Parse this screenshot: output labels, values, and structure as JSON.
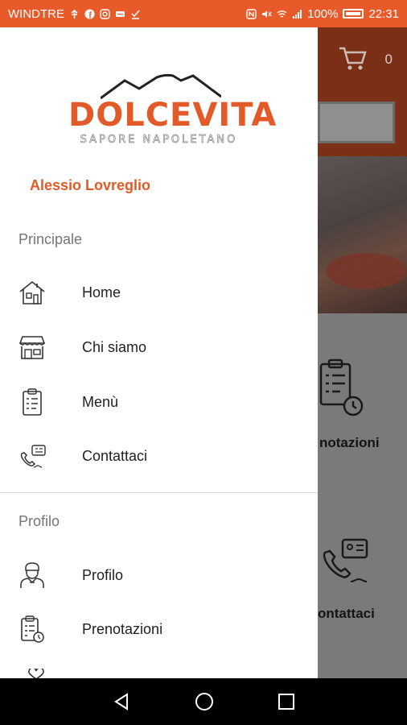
{
  "status_bar": {
    "carrier": "WINDTRE",
    "battery": "100%",
    "time": "22:31",
    "color": "#e85a2a"
  },
  "background": {
    "cart_count": "0",
    "tile_1_label": "notazioni",
    "tile_2_label": "ontattaci"
  },
  "drawer": {
    "logo": {
      "brand": "DOLCEVITA",
      "tagline": "SAPORE NAPOLETANO"
    },
    "user_name": "Alessio Lovreglio",
    "sections": {
      "main": "Principale",
      "profile": "Profilo"
    },
    "main_items": [
      {
        "label": "Home",
        "icon": "house-icon"
      },
      {
        "label": "Chi siamo",
        "icon": "shop-icon"
      },
      {
        "label": "Menù",
        "icon": "clipboard-list-icon"
      },
      {
        "label": "Contattaci",
        "icon": "phone-contact-icon"
      }
    ],
    "profile_items": [
      {
        "label": "Profilo",
        "icon": "chef-avatar-icon"
      },
      {
        "label": "Prenotazioni",
        "icon": "clipboard-clock-icon"
      }
    ],
    "accent_color": "#e25a28"
  }
}
